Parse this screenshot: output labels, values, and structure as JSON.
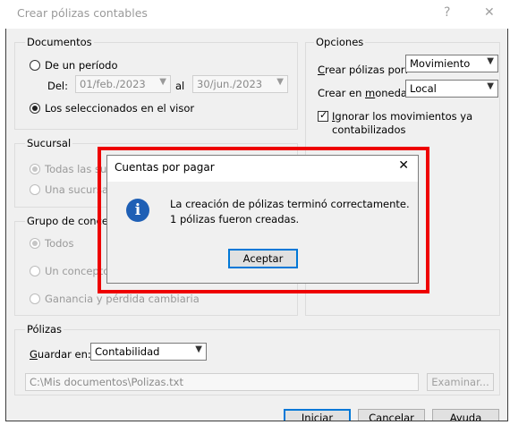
{
  "window": {
    "title": "Crear pólizas contables",
    "help_glyph": "?",
    "close_glyph": "✕"
  },
  "documentos": {
    "group_label": "Documentos",
    "periodo_label": "De un período",
    "del_label": "Del:",
    "del_value": "01/feb./2023",
    "al_label": "al",
    "al_value": "30/jun./2023",
    "seleccionados_label": "Los seleccionados en el visor"
  },
  "sucursal": {
    "group_label": "Sucursal",
    "todas_label": "Todas las sucursales",
    "una_label": "Una sucursal"
  },
  "grupo": {
    "group_label": "Grupo de conceptos",
    "todos_label": "Todos",
    "concepto_label": "Un concepto",
    "ganancia_label": "Ganancia y pérdida cambiaria"
  },
  "opciones": {
    "group_label": "Opciones",
    "crear_polizas_pre": "C",
    "crear_polizas_rest": "rear pólizas por:",
    "crear_polizas_value": "Movimiento",
    "moneda_pre": "Crear en ",
    "moneda_u": "m",
    "moneda_rest": "oneda:",
    "moneda_value": "Local",
    "ignorar_u": "I",
    "ignorar_line1_rest": "gnorar los movimientos ya",
    "ignorar_line2": "contabilizados"
  },
  "polizas": {
    "group_label": "Pólizas",
    "guardar_u": "G",
    "guardar_rest": "uardar en:",
    "guardar_value": "Contabilidad",
    "path_value": "C:\\Mis documentos\\Polizas.txt",
    "examinar_label": "Examinar..."
  },
  "footer": {
    "iniciar_label": "Iniciar",
    "cancelar_label": "Cancelar",
    "ayuda_label": "Ayuda"
  },
  "dialog": {
    "title": "Cuentas por pagar",
    "close_glyph": "✕",
    "line1": "La creación de pólizas terminó correctamente.",
    "line2": "1 pólizas fueron creadas.",
    "ok_label": "Aceptar",
    "icon": "info-icon"
  },
  "colors": {
    "highlight_border": "#ee0000",
    "info_icon": "#1e5fb5",
    "default_button_border": "#0078d7"
  }
}
